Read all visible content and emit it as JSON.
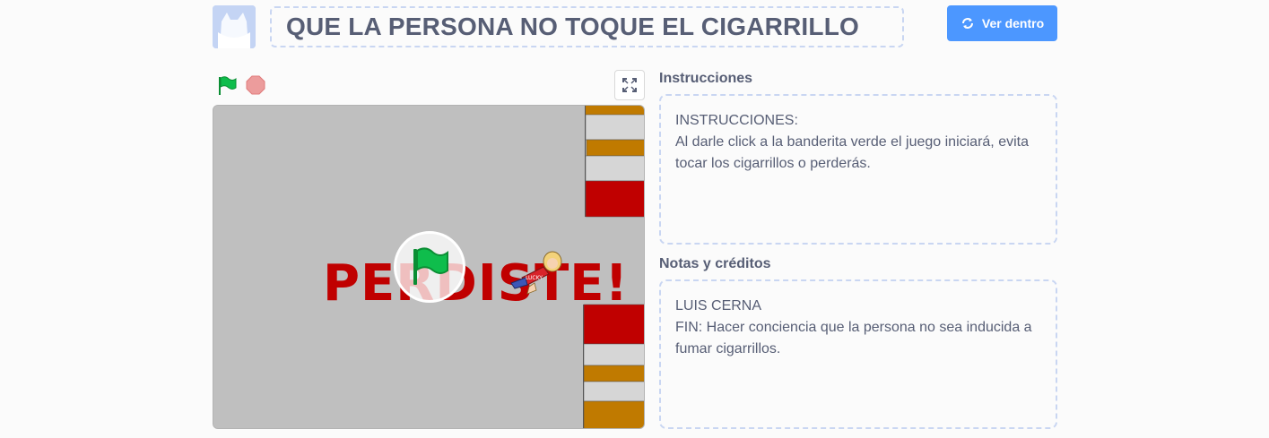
{
  "header": {
    "project_title": "QUE LA PERSONA NO TOQUE EL CIGARRILLO",
    "see_inside_label": "Ver dentro",
    "see_inside_icon": "remix-icon"
  },
  "controls": {
    "green_flag_icon": "green-flag-icon",
    "stop_icon": "stop-sign-icon",
    "fullscreen_icon": "fullscreen-icon"
  },
  "stage": {
    "game_over_text": "PERDISTE!",
    "sprite_tag": "LUCKY"
  },
  "instructions": {
    "label": "Instrucciones",
    "lines": [
      "INSTRUCCIONES:",
      "Al darle click a la banderita verde el juego iniciará, evita tocar los cigarrillos o perderás."
    ]
  },
  "notes": {
    "label": "Notas y créditos",
    "lines": [
      "LUIS CERNA",
      "FIN: Hacer conciencia que la persona no sea inducida a fumar cigarrillos."
    ]
  },
  "colors": {
    "accent": "#4c97ff",
    "text": "#575e75",
    "dashed_border": "#c9d6f2",
    "stage_bg": "#bfbfbf",
    "red_block": "#c00000",
    "orange_block": "#c07a00"
  }
}
